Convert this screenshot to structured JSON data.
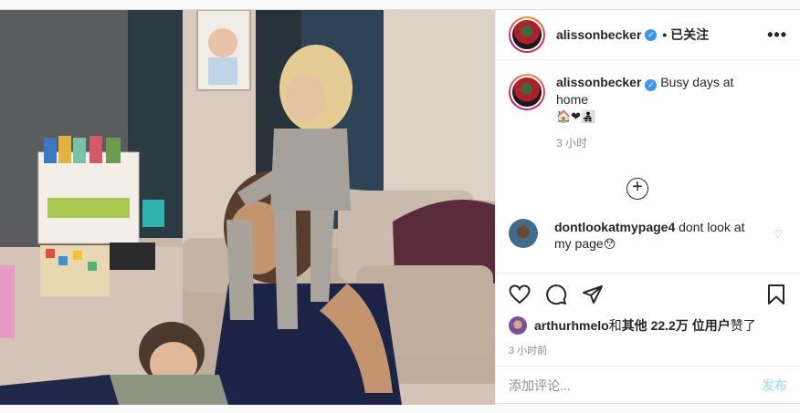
{
  "header": {
    "username": "alissonbecker",
    "verified_mark": "✓",
    "follow_state": "• 已关注",
    "more": "•••"
  },
  "caption": {
    "username": "alissonbecker",
    "text": "Busy days at home",
    "emojis": "🏠❤👨‍👧‍👦",
    "time": "3 小时"
  },
  "load_more": "+",
  "comments": [
    {
      "username": "dontlookatmypage4",
      "text": "dont look at my page",
      "emoji": "😯",
      "heart": "♡"
    }
  ],
  "actions": {
    "like_icon": "heart-outline-icon",
    "comment_icon": "comment-bubble-icon",
    "share_icon": "paper-plane-icon",
    "save_icon": "bookmark-icon"
  },
  "likes": {
    "first_user": "arthurhmelo",
    "connector": " 和 ",
    "others": "其他 22.2万 位用户",
    "suffix": " 赞了"
  },
  "posted_time": "3 小时前",
  "add_comment": {
    "placeholder": "添加评论...",
    "post_label": "发布"
  },
  "colors": {
    "link_blue_disabled": "#b2dffc",
    "verified_blue": "#3897f0",
    "secondary_text": "#8e8e8e",
    "border": "#efefef"
  }
}
